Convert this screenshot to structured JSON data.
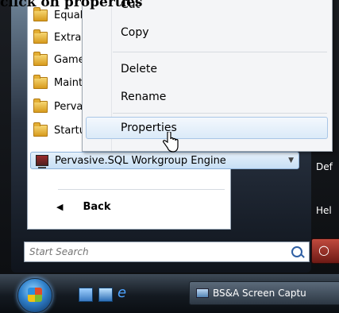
{
  "caption": "click on properties",
  "programs": [
    "Equaliz",
    "Extras",
    "Games",
    "Mainte",
    "Pervas",
    "Startup"
  ],
  "selected_program": "Pervasive.SQL Workgroup Engine",
  "back_label": "Back",
  "search_placeholder": "Start Search",
  "right_pane": {
    "default_label": "Def",
    "help_label": "Hel"
  },
  "context_menu": {
    "cut": "Cut",
    "copy": "Copy",
    "delete": "Delete",
    "rename": "Rename",
    "properties": "Properties"
  },
  "taskbar": {
    "window_title": "BS&A Screen Captu"
  }
}
